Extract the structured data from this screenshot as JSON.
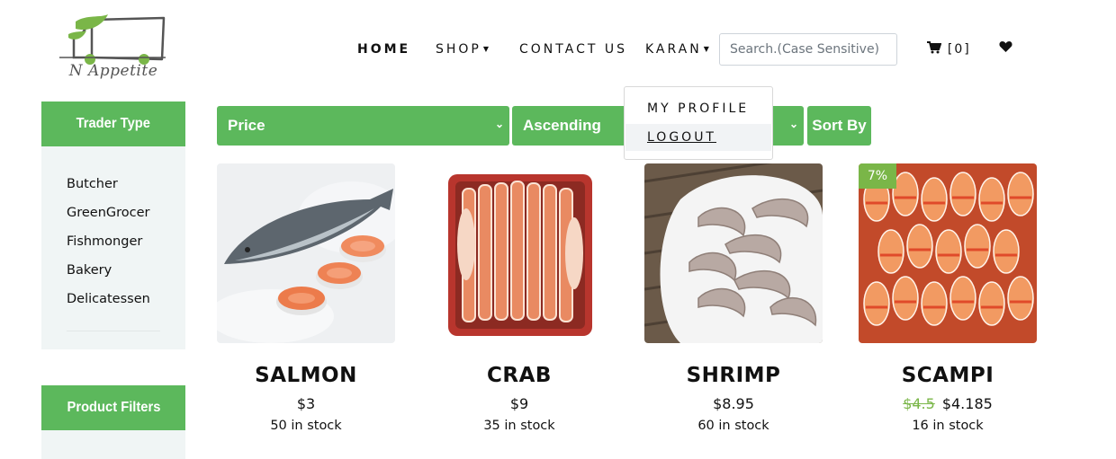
{
  "brand": {
    "logo_text": "N Appetite"
  },
  "nav": {
    "home": "HOME",
    "shop": "SHOP",
    "contact": "CONTACT US",
    "user": "KARAN"
  },
  "search": {
    "placeholder": "Search.(Case Sensitive)",
    "value": ""
  },
  "cart": {
    "icon": "cart-icon",
    "label": "[0]"
  },
  "wishlist": {
    "icon": "heart-icon"
  },
  "user_menu": {
    "items": [
      "MY PROFILE",
      "LOGOUT"
    ]
  },
  "sidebar": {
    "trader_title": "Trader Type",
    "trader_types": [
      "Butcher",
      "GreenGrocer",
      "Fishmonger",
      "Bakery",
      "Delicatessen"
    ],
    "filter_title": "Product Filters"
  },
  "sort": {
    "field": "Price",
    "order": "Ascending",
    "button": "Sort By"
  },
  "colors": {
    "accent": "#5cb85c",
    "discount": "#7ab648"
  },
  "products": [
    {
      "name": "SALMON",
      "price": "$3",
      "stock": "50 in stock",
      "badge": "",
      "old_price": ""
    },
    {
      "name": "CRAB",
      "price": "$9",
      "stock": "35 in stock",
      "badge": "",
      "old_price": ""
    },
    {
      "name": "SHRIMP",
      "price": "$8.95",
      "stock": "60 in stock",
      "badge": "",
      "old_price": ""
    },
    {
      "name": "SCAMPI",
      "price": "$4.185",
      "stock": "16 in stock",
      "badge": "7%",
      "old_price": "$4.5"
    }
  ]
}
